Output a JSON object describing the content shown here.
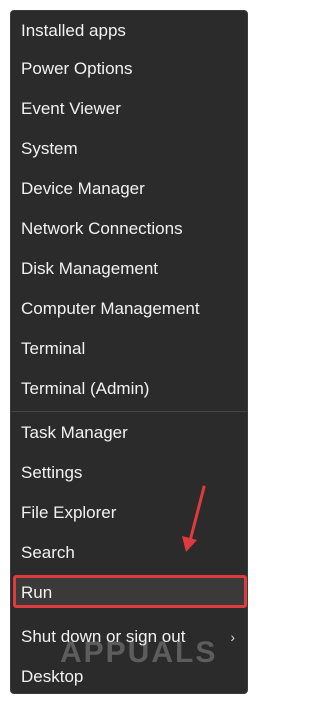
{
  "menu": {
    "items": [
      {
        "label": "Installed apps"
      },
      {
        "label": "Power Options"
      },
      {
        "label": "Event Viewer"
      },
      {
        "label": "System"
      },
      {
        "label": "Device Manager"
      },
      {
        "label": "Network Connections"
      },
      {
        "label": "Disk Management"
      },
      {
        "label": "Computer Management"
      },
      {
        "label": "Terminal"
      },
      {
        "label": "Terminal (Admin)"
      },
      {
        "label": "Task Manager"
      },
      {
        "label": "Settings"
      },
      {
        "label": "File Explorer"
      },
      {
        "label": "Search"
      },
      {
        "label": "Run"
      },
      {
        "label": "Shut down or sign out"
      },
      {
        "label": "Desktop"
      }
    ],
    "submenu_chevron": "›",
    "highlight_color": "#e0393e",
    "arrow_color": "#e0393e"
  },
  "watermark": {
    "text": "APPUALS"
  }
}
